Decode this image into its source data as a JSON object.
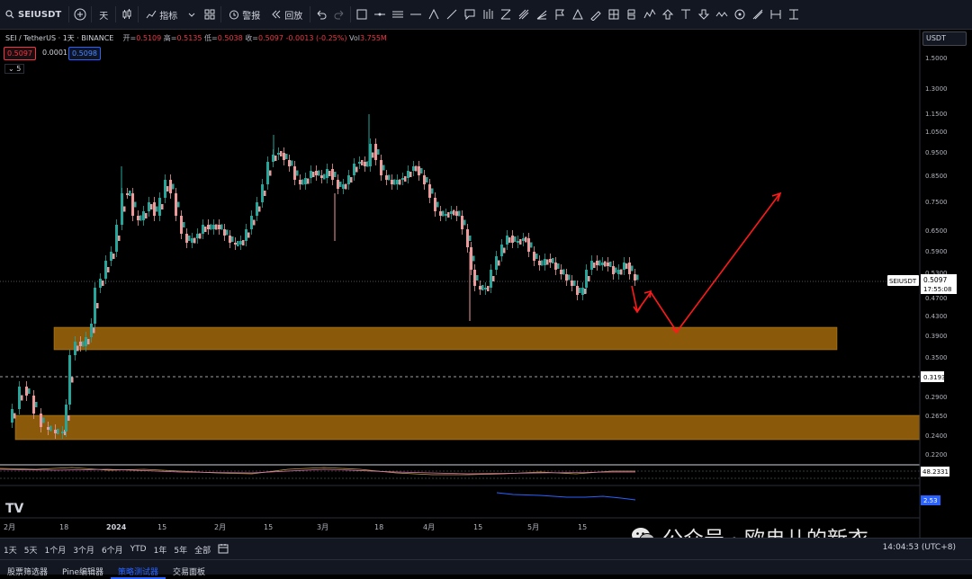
{
  "toolbar": {
    "symbol": "SEIUSDT",
    "interval": "天",
    "indicators_label": "指标",
    "alert_label": "警报",
    "replay_label": "回放"
  },
  "legend": {
    "pair": "SEI / TetherUS · 1天 · BINANCE",
    "open_label": "开=",
    "open": "0.5109",
    "high_label": "高=",
    "high": "0.5135",
    "low_label": "低=",
    "low": "0.5038",
    "close_label": "收=",
    "close": "0.5097",
    "change": "-0.0013 (-0.25%)",
    "vol_label": "Vol",
    "vol": "3.755M"
  },
  "trade": {
    "sell": "0.5097",
    "spread": "0.0001",
    "buy": "0.5098"
  },
  "indicator_collapse": "5",
  "currency": "USDT",
  "price_axis": {
    "ticks": [
      "1.5000",
      "1.3000",
      "1.1500",
      "1.0500",
      "0.9500",
      "0.8500",
      "0.7500",
      "0.6500",
      "0.5900",
      "0.5300",
      "0.4700",
      "0.4300",
      "0.3900",
      "0.3500",
      "0.3193",
      "0.2900",
      "0.2650",
      "0.2400",
      "0.2200"
    ],
    "last_symbol": "SEIUSDT",
    "last_price": "0.5097",
    "countdown": "17:55:08",
    "hline_price": "0.3193"
  },
  "oscillator": {
    "value": "48.2331",
    "value2": "2.53"
  },
  "time_axis": [
    "2月",
    "18",
    "2024",
    "15",
    "2月",
    "15",
    "3月",
    "18",
    "4月",
    "15",
    "5月",
    "15"
  ],
  "timeframes": [
    "1天",
    "5天",
    "1个月",
    "3个月",
    "6个月",
    "YTD",
    "1年",
    "5年",
    "全部"
  ],
  "clock": "14:04:53 (UTC+8)",
  "panels": [
    "股票筛选器",
    "Pine编辑器",
    "策略测试器",
    "交易面板"
  ],
  "watermark": "公众号 · 欧冉儿的新衣",
  "logo": "TV",
  "colors": {
    "up": "#26a69a",
    "down": "#ef9a9a",
    "zone": "#8a5a0a",
    "arrow": "#ff1a1a",
    "bg": "#000000"
  }
}
